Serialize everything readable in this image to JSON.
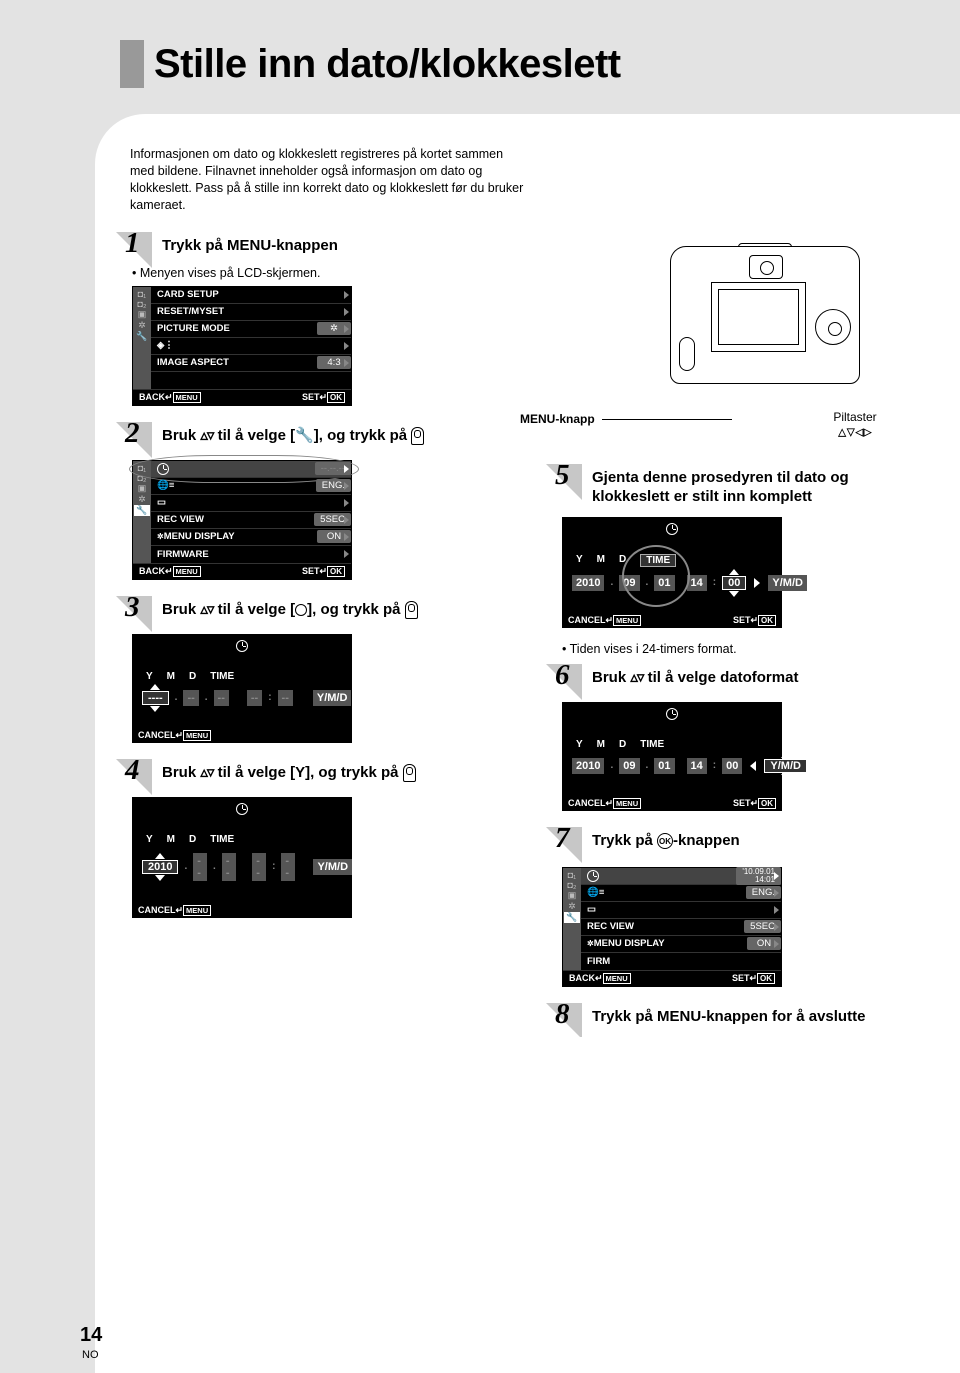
{
  "page": {
    "number": "14",
    "lang": "NO"
  },
  "title": "Stille inn dato/klokkeslett",
  "intro": "Informasjonen om dato og klokkeslett registreres på kortet sammen med bildene. Filnavnet inneholder også informasjon om dato og klokkeslett. Pass på å stille inn korrekt dato og klokkeslett før du bruker kameraet.",
  "camera": {
    "menu_knapp": "MENU-knapp",
    "piltaster": "Piltaster",
    "piltaster_glyphs": "▵▿◃▹"
  },
  "steps": {
    "s1": {
      "num": "1",
      "title_a": "Trykk på ",
      "title_b": "MENU",
      "title_c": "-knappen",
      "bullet": "Menyen vises på LCD-skjermen."
    },
    "s2": {
      "num": "2",
      "title_a": "Bruk ",
      "title_b": " til å velge [",
      "title_c": "], og trykk på "
    },
    "s3": {
      "num": "3",
      "title_a": "Bruk ",
      "title_b": " til å velge [",
      "title_c": "], og trykk på "
    },
    "s4": {
      "num": "4",
      "title_a": "Bruk ",
      "title_b": " til å velge [Y], og trykk på "
    },
    "s5": {
      "num": "5",
      "title": "Gjenta denne prosedyren til dato og klokkeslett er stilt inn komplett"
    },
    "s5_note": "Tiden vises i 24-timers format.",
    "s6": {
      "num": "6",
      "title_a": "Bruk ",
      "title_b": " til å velge datoformat"
    },
    "s7": {
      "num": "7",
      "title_a": "Trykk på ",
      "title_b": "-knappen",
      "ok": "OK"
    },
    "s8": {
      "num": "8",
      "title_a": "Trykk på ",
      "title_b": "MENU",
      "title_c": "-knappen for å avslutte"
    }
  },
  "lcd1": {
    "row1": "CARD SETUP",
    "row2": "RESET/MYSET",
    "row3": "PICTURE MODE",
    "row5": "IMAGE ASPECT",
    "row5_val": "4:3",
    "back": "BACK",
    "menu": "MENU",
    "set": "SET",
    "ok": "OK"
  },
  "lcd2": {
    "clock_date": "--.--.--",
    "lang_row_val": "ENG.",
    "row_rec": "REC VIEW",
    "row_rec_val": "5SEC",
    "row_menu": "MENU DISPLAY",
    "row_menu_val": "ON",
    "row_fw": "FIRMWARE",
    "back": "BACK",
    "menu": "MENU",
    "set": "SET",
    "ok": "OK"
  },
  "lcd3": {
    "labels": {
      "y": "Y",
      "m": "M",
      "d": "D",
      "t": "TIME"
    },
    "vals": {
      "y": "----",
      "m": "--",
      "d": "--",
      "h": "--",
      "min": "--",
      "fmt": "Y/M/D"
    },
    "cancel": "CANCEL",
    "menu": "MENU"
  },
  "lcd4": {
    "labels": {
      "y": "Y",
      "m": "M",
      "d": "D",
      "t": "TIME"
    },
    "vals": {
      "y": "2010",
      "m": "--",
      "d": "--",
      "h": "--",
      "min": "--",
      "fmt": "Y/M/D"
    },
    "cancel": "CANCEL",
    "menu": "MENU"
  },
  "lcd5": {
    "labels": {
      "y": "Y",
      "m": "M",
      "d": "D",
      "t": "TIME"
    },
    "vals": {
      "y": "2010",
      "m": "09",
      "d": "01",
      "h": "14",
      "min": "00",
      "fmt": "Y/M/D"
    },
    "cancel": "CANCEL",
    "menu": "MENU",
    "set": "SET",
    "ok": "OK"
  },
  "lcd6": {
    "labels": {
      "y": "Y",
      "m": "M",
      "d": "D",
      "t": "TIME"
    },
    "vals": {
      "y": "2010",
      "m": "09",
      "d": "01",
      "h": "14",
      "min": "00",
      "fmt": "Y/M/D"
    },
    "cancel": "CANCEL",
    "menu": "MENU",
    "set": "SET",
    "ok": "OK"
  },
  "lcd7": {
    "clock_date": "'10.09.01",
    "clock_time": "14:01",
    "lang_row_val": "ENG.",
    "row_rec": "REC VIEW",
    "row_rec_val": "5SEC",
    "row_menu": "MENU DISPLAY",
    "row_menu_val": "ON",
    "row_fw": "FIRM",
    "back": "BACK",
    "menu": "MENU",
    "set": "SET",
    "ok": "OK"
  }
}
